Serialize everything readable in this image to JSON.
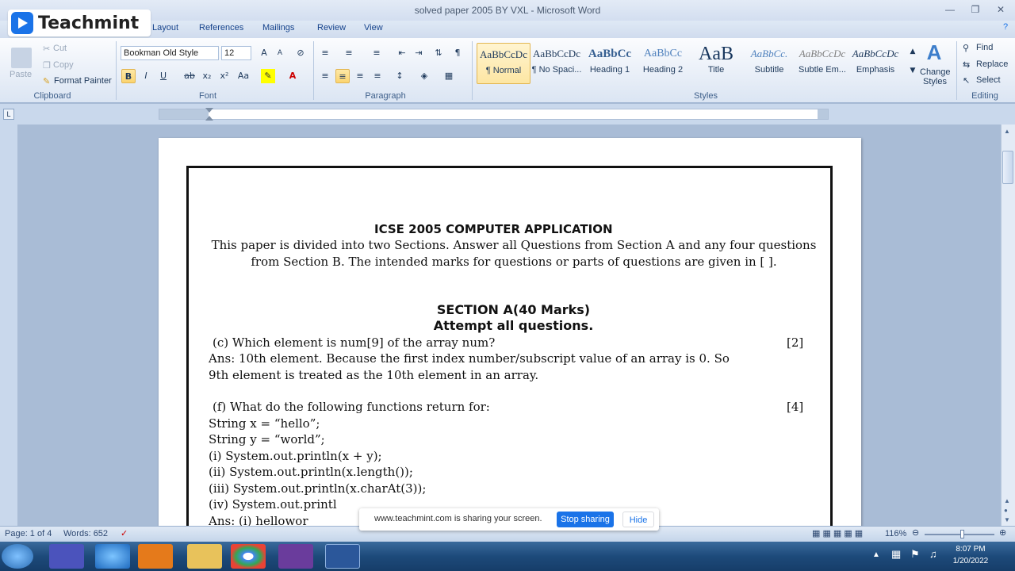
{
  "window": {
    "title": "solved paper 2005 BY VXL - Microsoft Word"
  },
  "logo": {
    "brand": "Teachmint"
  },
  "tabs": [
    "Layout",
    "References",
    "Mailings",
    "Review",
    "View"
  ],
  "ribbon": {
    "clipboard": {
      "paste": "Paste",
      "cut": "Cut",
      "copy": "Copy",
      "format_painter": "Format Painter",
      "label": "Clipboard"
    },
    "font": {
      "name": "Bookman Old Style",
      "size": "12",
      "label": "Font"
    },
    "paragraph": {
      "label": "Paragraph"
    },
    "styles": {
      "items": [
        {
          "preview": "AaBbCcDc",
          "name": "¶ Normal"
        },
        {
          "preview": "AaBbCcDc",
          "name": "¶ No Spaci..."
        },
        {
          "preview": "AaBbCc",
          "name": "Heading 1"
        },
        {
          "preview": "AaBbCc",
          "name": "Heading 2"
        },
        {
          "preview": "AaB",
          "name": "Title"
        },
        {
          "preview": "AaBbCc.",
          "name": "Subtitle"
        },
        {
          "preview": "AaBbCcDc",
          "name": "Subtle Em..."
        },
        {
          "preview": "AaBbCcDc",
          "name": "Emphasis"
        }
      ],
      "change_styles": "Change Styles",
      "label": "Styles"
    },
    "editing": {
      "find": "Find",
      "replace": "Replace",
      "select": "Select",
      "label": "Editing"
    }
  },
  "document": {
    "title": "ICSE 2005 COMPUTER APPLICATION",
    "intro": "This paper is divided into two Sections. Answer all Questions from Section A and any four questions from Section B. The intended marks for questions or parts of questions are given in [ ].",
    "section_heading": "SECTION A(40 Marks)",
    "section_sub": "Attempt all questions.",
    "q_c": "(c) Which element is num[9] of the array num?",
    "q_c_marks": "[2]",
    "ans_c_line1": "Ans: 10th element. Because the first index number/subscript value of an array is 0. So",
    "ans_c_line2": "9th element is treated as the 10th element in an array.",
    "q_f": "(f) What do the following functions return for:",
    "q_f_marks": "[4]",
    "code": [
      "String x = “hello”;",
      "String y = “world”;",
      "(i)   System.out.println(x + y);",
      "(ii)  System.out.println(x.length());",
      "(iii) System.out.println(x.charAt(3));",
      "(iv)  System.out.printl"
    ],
    "answer_start": "Ans:      (i)     hellowor"
  },
  "status": {
    "page": "Page: 1 of 4",
    "words": "Words: 652",
    "zoom": "116%"
  },
  "share": {
    "message": "www.teachmint.com is sharing your screen.",
    "stop": "Stop sharing",
    "hide": "Hide"
  },
  "clock": {
    "time": "8:07 PM",
    "date": "1/20/2022"
  }
}
